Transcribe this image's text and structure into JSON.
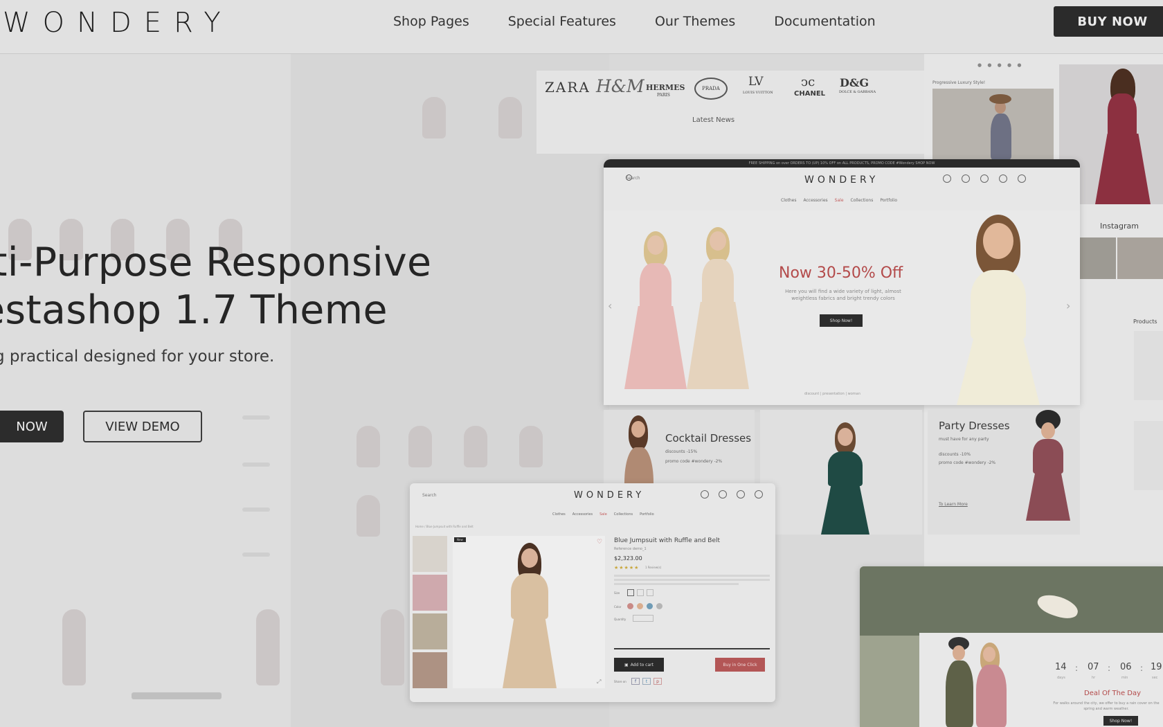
{
  "header": {
    "logo": "WONDERY",
    "nav": [
      "Shop Pages",
      "Special Features",
      "Our Themes",
      "Documentation"
    ],
    "buy_now": "BUY NOW"
  },
  "hero": {
    "title_line1": "lti-Purpose Responsive",
    "title_line2": "estashop 1.7 Theme",
    "subtitle": "g practical designed for your store.",
    "primary_button": "NOW",
    "secondary_button": "VIEW DEMO"
  },
  "brands": {
    "items": [
      "ZARA",
      "H&M",
      "HERMES",
      "PRADA",
      "LV",
      "CHANEL",
      "D&G"
    ],
    "sub_hermes": "PARIS",
    "sub_lv": "LOUIS VUITTON",
    "sub_dg": "DOLCE & GABBANA",
    "latest_news": "Latest News"
  },
  "side_panel": {
    "caption": "Progressive Luxury Style!",
    "instagram": "Instagram",
    "products": "Products"
  },
  "home_window": {
    "topbar": "FREE SHIPPING on over ORDERS TO (UP) 10% OFF on ALL PRODUCTS, PROMO CODE #Wondery SHOP NOW",
    "logo": "WONDERY",
    "search": "Search",
    "menu": [
      "Clothes",
      "Accessories",
      "Sale",
      "Collections",
      "Portfolio"
    ],
    "promo_title": "Now 30-50% Off",
    "promo_text": "Here you will find a wide variety of light, almost weightless fabrics and bright trendy colors",
    "shop_now": "Shop Now!",
    "slider_caption": "discount | presentation | woman",
    "cat1_title": "Cocktail Dresses",
    "cat1_line1": "discounts -15%",
    "cat1_line2": "promo code #wondery -2%",
    "cat2_title": "Party Dresses",
    "cat2_line1": "must have for any party",
    "cat2_line2": "discounts -10%",
    "cat2_line3": "promo code #wondery -2%",
    "cat2_link": "To Learn More"
  },
  "product_window": {
    "logo": "WONDERY",
    "search": "Search",
    "menu": [
      "Clothes",
      "Accessories",
      "Sale",
      "Collections",
      "Portfolio"
    ],
    "breadcrumb": "Home / Blue Jumpsuit with Ruffle and Belt",
    "badge": "New",
    "title": "Blue Jumpsuit with Ruffle and Belt",
    "reference": "Reference demo_1",
    "price": "$2,323.00",
    "stars": "★★★★★",
    "reviews": "1 Review(s)",
    "size_label": "Size",
    "color_label": "Color",
    "qty_label": "Quantity",
    "add_to_cart": "Add to cart",
    "buy_one_click": "Buy in One Click",
    "share": "Share on",
    "swatch_colors": [
      "#c98a86",
      "#d9ad8e",
      "#6f9bb5",
      "#b5b5b5"
    ]
  },
  "deal_window": {
    "countdown": [
      "14",
      "07",
      "06",
      "19"
    ],
    "labels": [
      "days",
      "hr",
      "min",
      "sec"
    ],
    "deal_title": "Deal Of The Day",
    "deal_text": "For walks around the city, we offer to buy a rain cover on the spring and warm weather.",
    "shop_now": "Shop Now!"
  },
  "colors": {
    "accent_red": "#b34a4a",
    "dark_button": "#2b2b2b",
    "background": "#d9d9d9"
  }
}
